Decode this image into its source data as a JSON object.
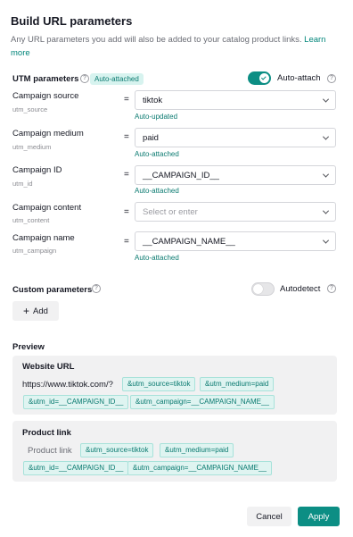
{
  "header": {
    "title": "Build URL parameters",
    "description": "Any URL parameters you add will also be added to your catalog product links.",
    "learn_more": "Learn more"
  },
  "utm": {
    "label": "UTM parameters",
    "badge": "Auto-attached",
    "toggle_label": "Auto-attach",
    "toggle_on": true,
    "params": [
      {
        "name": "Campaign source",
        "key": "utm_source",
        "value": "tiktok",
        "placeholder": "",
        "hint": "Auto-updated"
      },
      {
        "name": "Campaign medium",
        "key": "utm_medium",
        "value": "paid",
        "placeholder": "",
        "hint": "Auto-attached"
      },
      {
        "name": "Campaign ID",
        "key": "utm_id",
        "value": "__CAMPAIGN_ID__",
        "placeholder": "",
        "hint": "Auto-attached"
      },
      {
        "name": "Campaign content",
        "key": "utm_content",
        "value": "",
        "placeholder": "Select or enter",
        "hint": ""
      },
      {
        "name": "Campaign name",
        "key": "utm_campaign",
        "value": "__CAMPAIGN_NAME__",
        "placeholder": "",
        "hint": "Auto-attached"
      }
    ]
  },
  "custom": {
    "label": "Custom parameters",
    "toggle_label": "Autodetect",
    "toggle_on": false,
    "add_label": "Add"
  },
  "preview": {
    "label": "Preview",
    "website": {
      "title": "Website URL",
      "url": "https://www.tiktok.com/?",
      "tags": [
        "&utm_source=tiktok",
        "&utm_medium=paid",
        "&utm_id=__CAMPAIGN_ID__",
        "&utm_campaign=__CAMPAIGN_NAME__"
      ]
    },
    "product": {
      "title": "Product link",
      "label": "Product link",
      "tags": [
        "&utm_source=tiktok",
        "&utm_medium=paid",
        "&utm_id=__CAMPAIGN_ID__",
        "&utm_campaign=__CAMPAIGN_NAME__"
      ]
    }
  },
  "footer": {
    "cancel": "Cancel",
    "apply": "Apply"
  },
  "colors": {
    "accent": "#0c8e84",
    "accent_text": "#0a7a70"
  }
}
